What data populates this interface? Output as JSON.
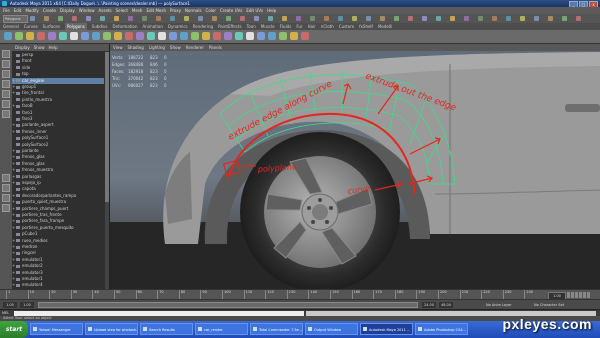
{
  "window": {
    "title": "Autodesk Maya 2011 x64 [C:\\Daily Dogue\\..\\..\\Painting scenes\\dealer.mb] --- polySurface1",
    "buttons": [
      "_",
      "□",
      "x"
    ]
  },
  "menubar": [
    "File",
    "Edit",
    "Modify",
    "Create",
    "Display",
    "Window",
    "Assets",
    "Select",
    "Mesh",
    "Edit Mesh",
    "Proxy",
    "Normals",
    "Color",
    "Create UVs",
    "Edit UVs",
    "Help"
  ],
  "statusline": {
    "mode": "Polygons"
  },
  "shelf_tabs": {
    "items": [
      "General",
      "Curves",
      "Surfaces",
      "Polygons",
      "Subdivs",
      "Deformation",
      "Animation",
      "Dynamics",
      "Rendering",
      "PaintEffects",
      "Toon",
      "Muscle",
      "Fluids",
      "Fur",
      "Hair",
      "nCloth",
      "Custom",
      "fxShelf",
      "Modelli"
    ],
    "active": "Polygons"
  },
  "outliner": {
    "menu": [
      "Display",
      "Show",
      "Help"
    ],
    "selected_index": 4,
    "rows": [
      {
        "label": "persp",
        "expand": ""
      },
      {
        "label": "front",
        "expand": ""
      },
      {
        "label": "side",
        "expand": ""
      },
      {
        "label": "top",
        "expand": ""
      },
      {
        "label": "car_engine",
        "expand": "+"
      },
      {
        "label": "group1",
        "expand": "+"
      },
      {
        "label": "tire_frontal",
        "expand": "+"
      },
      {
        "label": "pintlo_muestra",
        "expand": ""
      },
      {
        "label": "faroB",
        "expand": "+"
      },
      {
        "label": "faro1",
        "expand": ""
      },
      {
        "label": "faro3",
        "expand": ""
      },
      {
        "label": "parlante_aspert",
        "expand": "+"
      },
      {
        "label": "frenos_inner",
        "expand": "+"
      },
      {
        "label": "polySurface1",
        "expand": ""
      },
      {
        "label": "polySurface2",
        "expand": ""
      },
      {
        "label": "parlante",
        "expand": "+"
      },
      {
        "label": "frenos_glas",
        "expand": "+"
      },
      {
        "label": "frenos_glas",
        "expand": "+"
      },
      {
        "label": "frenos_muestra",
        "expand": "+"
      },
      {
        "label": "parlasgas",
        "expand": "+"
      },
      {
        "label": "espejo_ip",
        "expand": "+"
      },
      {
        "label": "capota",
        "expand": ""
      },
      {
        "label": "decoradorparlantes_rampo",
        "expand": "+"
      },
      {
        "label": "puerto_quiet_muestra",
        "expand": "+"
      },
      {
        "label": "portiere_champs_puert",
        "expand": "+"
      },
      {
        "label": "portiere_tras_frente",
        "expand": "+"
      },
      {
        "label": "portiere_fara_frampe",
        "expand": "+"
      },
      {
        "label": "portiere_puerto_mesquito",
        "expand": "+"
      },
      {
        "label": "pCube1",
        "expand": ""
      },
      {
        "label": "rueo_medios",
        "expand": "+"
      },
      {
        "label": "medron",
        "expand": "+"
      },
      {
        "label": "ringcel",
        "expand": "+"
      },
      {
        "label": "emulator1",
        "expand": "+"
      },
      {
        "label": "emulator2",
        "expand": "+"
      },
      {
        "label": "emulator3",
        "expand": "+"
      },
      {
        "label": "emulator1",
        "expand": "+"
      },
      {
        "label": "emulator4",
        "expand": "+"
      }
    ]
  },
  "viewport": {
    "panel_menu": [
      "View",
      "Shading",
      "Lighting",
      "Show",
      "Renderer",
      "Panels"
    ],
    "hud": [
      {
        "label": "Verts:",
        "v1": "188722",
        "v2": "823",
        "v3": "0"
      },
      {
        "label": "Edges:",
        "v1": "368488",
        "v2": "846",
        "v3": "0"
      },
      {
        "label": "Faces:",
        "v1": "182918",
        "v2": "823",
        "v3": "0"
      },
      {
        "label": "Tris:",
        "v1": "370042",
        "v2": "823",
        "v3": "0"
      },
      {
        "label": "UVs:",
        "v1": "986027",
        "v2": "823",
        "v3": "0"
      }
    ],
    "annotations": [
      "extrude edge along curve",
      "extrude out the edge",
      "polyplane",
      "curve"
    ]
  },
  "timeslider": {
    "ticks": [
      "1",
      "10",
      "20",
      "30",
      "40",
      "50",
      "60",
      "70",
      "80",
      "90",
      "100",
      "110",
      "120",
      "130",
      "140",
      "150",
      "160",
      "170",
      "180",
      "190",
      "200",
      "210",
      "220",
      "230",
      "240"
    ],
    "current": "1.00"
  },
  "range": {
    "start": "1.00",
    "in": "1.00",
    "out": "24.00",
    "end": "48.00",
    "anim_layer": "No Anim Layer",
    "char_set": "No Character Set"
  },
  "cmdline": {
    "label": "MEL"
  },
  "helpline": {
    "text": "Select Tool: select an object"
  },
  "taskbar": {
    "start": "start",
    "items": [
      {
        "label": "Yahoo! Messenger",
        "active": false
      },
      {
        "label": "Upload step for photosh...",
        "active": false
      },
      {
        "label": "Search Results",
        "active": false
      },
      {
        "label": "car_render",
        "active": false
      },
      {
        "label": "Total Commander 7.5a -...",
        "active": false
      },
      {
        "label": "Output Window",
        "active": false
      },
      {
        "label": "Autodesk Maya 2011 ...",
        "active": true
      },
      {
        "label": "Adobe Photoshop CS4...",
        "active": false
      }
    ]
  },
  "watermark": "pxleyes.com",
  "colors": {
    "annotation": "#e2271e",
    "wireframe": "#3ddc8a",
    "selection": "#5d7fa6",
    "taskbar": "#2b5fcf"
  }
}
